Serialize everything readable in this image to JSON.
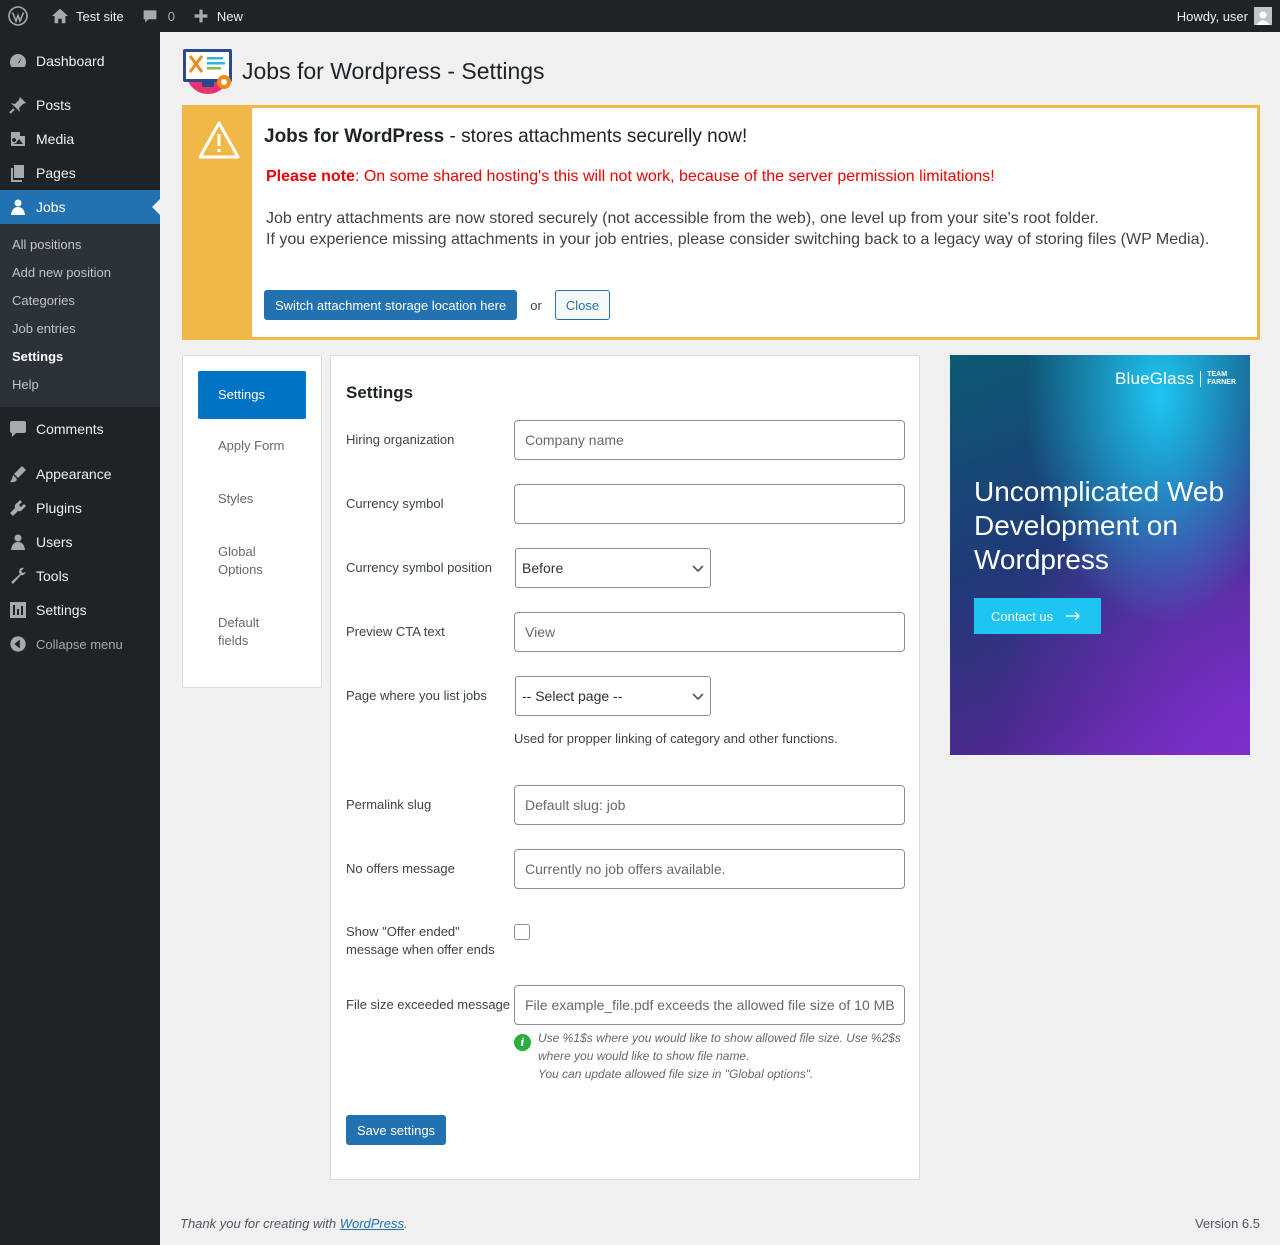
{
  "adminbar": {
    "site_name": "Test site",
    "comments_count": "0",
    "new_label": "New",
    "howdy": "Howdy, user"
  },
  "sidebar": {
    "items": [
      {
        "label": "Dashboard",
        "icon": "dashboard-icon"
      },
      {
        "label": "Posts",
        "icon": "pin-icon"
      },
      {
        "label": "Media",
        "icon": "media-icon"
      },
      {
        "label": "Pages",
        "icon": "pages-icon"
      },
      {
        "label": "Jobs",
        "icon": "person-icon"
      }
    ],
    "jobs_submenu": [
      "All positions",
      "Add new position",
      "Categories",
      "Job entries",
      "Settings",
      "Help"
    ],
    "items2": [
      {
        "label": "Comments",
        "icon": "comment-icon"
      },
      {
        "label": "Appearance",
        "icon": "brush-icon"
      },
      {
        "label": "Plugins",
        "icon": "plug-icon"
      },
      {
        "label": "Users",
        "icon": "users-icon"
      },
      {
        "label": "Tools",
        "icon": "wrench-icon"
      },
      {
        "label": "Settings",
        "icon": "settings-icon"
      }
    ],
    "collapse": "Collapse menu"
  },
  "page": {
    "title": "Jobs for Wordpress - Settings"
  },
  "notice": {
    "title_bold": "Jobs for WordPress",
    "title_rest": " - stores attachments securelly now!",
    "warn_bold": "Please note",
    "warn_rest": ": On some shared hosting's this will not work, because of the server permission limitations!",
    "desc_line1": "Job entry attachments are now stored securely (not accessible from the web), one level up from your site's root folder.",
    "desc_line2": "If you experience missing attachments in your job entries, please consider switching back to a legacy way of storing files (WP Media).",
    "switch_button": "Switch attachment storage location here",
    "or": "or",
    "close_button": "Close",
    "accent": "#f0b849"
  },
  "tabs": [
    "Settings",
    "Apply Form",
    "Styles",
    "Global Options",
    "Default fields"
  ],
  "form": {
    "heading": "Settings",
    "hiring_org": {
      "label": "Hiring organization",
      "placeholder": "Company name"
    },
    "currency_symbol": {
      "label": "Currency symbol",
      "value": ""
    },
    "currency_position": {
      "label": "Currency symbol position",
      "selected": "Before"
    },
    "preview_cta": {
      "label": "Preview CTA text",
      "placeholder": "View"
    },
    "list_page": {
      "label": "Page where you list jobs",
      "selected": "-- Select page --",
      "help": "Used for propper linking of category and other functions."
    },
    "permalink": {
      "label": "Permalink slug",
      "placeholder": "Default slug: job"
    },
    "no_offers": {
      "label": "No offers message",
      "placeholder": "Currently no job offers available."
    },
    "offer_ended": {
      "label": "Show \"Offer ended\" message when offer ends"
    },
    "file_size": {
      "label": "File size exceeded message",
      "placeholder": "File example_file.pdf exceeds the allowed file size of 10 MB",
      "info1": "Use %1$s where you would like to show allowed file size. Use %2$s where you would like to show file name.",
      "info2": "You can update allowed file size in \"Global options\"."
    },
    "save_button": "Save settings"
  },
  "promo": {
    "brand": "BlueGlass",
    "brand_team_1": "TEAM",
    "brand_team_2": "FARNER",
    "headline": "Uncomplicated Web Development on Wordpress",
    "cta": "Contact us"
  },
  "footer": {
    "thanks_prefix": "Thank you for creating with ",
    "thanks_link": "WordPress",
    "thanks_suffix": ".",
    "version": "Version 6.5"
  },
  "colors": {
    "admin_dark": "#1d2327",
    "wp_blue": "#2271b1",
    "tab_active": "#0073c5",
    "warning_red": "#e00000"
  }
}
